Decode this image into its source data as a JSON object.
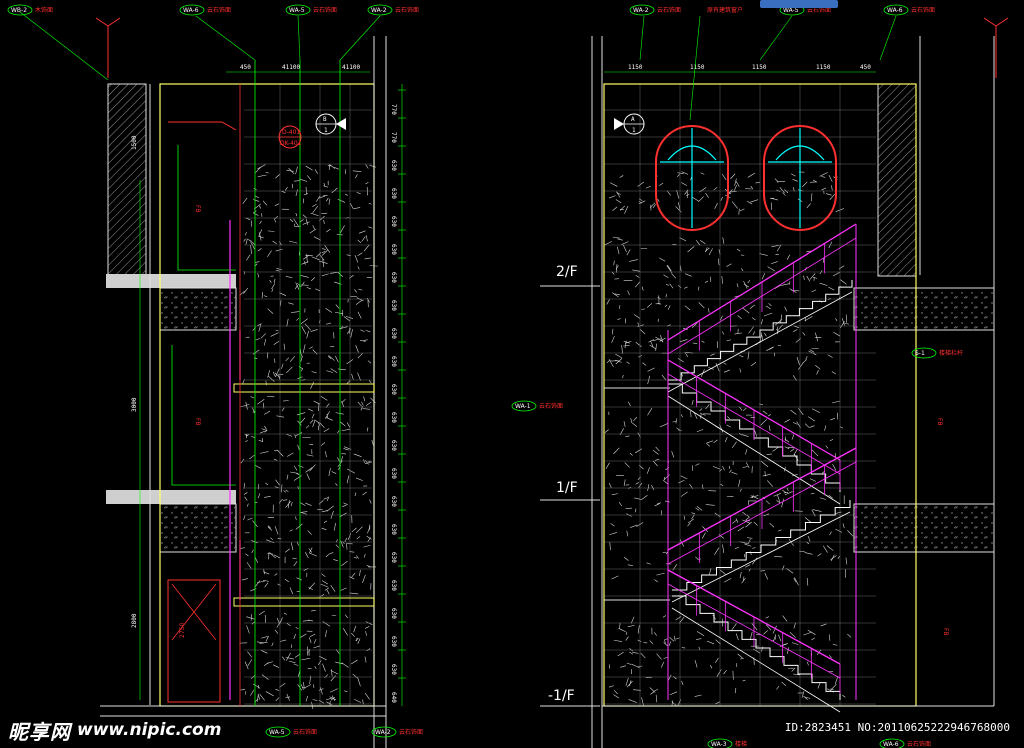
{
  "watermark": {
    "brand": "昵享网",
    "url": "www.nipic.com",
    "id_line": "ID:2823451 NO:20110625222946768000"
  },
  "levels": [
    "2/F",
    "1/F",
    "-1/F"
  ],
  "left_elevation": {
    "top_dims": [
      "450",
      "41100",
      "41100"
    ],
    "left_dims": [
      "1500",
      "3000",
      "2800"
    ],
    "door_dim": "2750",
    "right_dims": [
      "770",
      "770",
      "630",
      "630",
      "630",
      "630",
      "630",
      "630",
      "630",
      "630",
      "630",
      "630",
      "630",
      "630",
      "630",
      "630",
      "630",
      "630",
      "630",
      "630",
      "630",
      "640"
    ],
    "top_tags": [
      {
        "tag": "WB-2",
        "label": "木饰面"
      },
      {
        "tag": "WA-6",
        "label": "云石饰面"
      },
      {
        "tag": "WA-5",
        "label": "云石饰面"
      },
      {
        "tag": "WA-2",
        "label": "云石饰面"
      }
    ],
    "bottom_tags": [
      {
        "tag": "WA-5",
        "label": "云石饰面"
      },
      {
        "tag": "WA-2",
        "label": "云石饰面"
      }
    ],
    "section_bubble": {
      "letter": "B",
      "num": "1"
    },
    "detail_bubble": {
      "top": "D-401",
      "bottom": "DK-401"
    },
    "notes": [
      "FB",
      "FB",
      "FB"
    ]
  },
  "right_elevation": {
    "top_dims": [
      "1150",
      "1150",
      "1150",
      "1150",
      "450"
    ],
    "top_tags": [
      {
        "tag": "WA-2",
        "label": "云石饰面"
      },
      {
        "tag": "",
        "label": "原有建筑窗户"
      },
      {
        "tag": "WA-5",
        "label": "云石饰面"
      },
      {
        "tag": "WA-6",
        "label": "云石饰面"
      }
    ],
    "side_tags": [
      {
        "tag": "WA-1",
        "label": "云石饰面"
      },
      {
        "tag": "S-1",
        "label": "楼梯栏杆"
      }
    ],
    "bottom_tags": [
      {
        "tag": "WA-3",
        "label": "楼梯"
      },
      {
        "tag": "WA-6",
        "label": "云石饰面"
      }
    ],
    "section_bubble": {
      "letter": "A",
      "num": "1"
    },
    "notes": [
      "FB",
      "FB"
    ]
  }
}
